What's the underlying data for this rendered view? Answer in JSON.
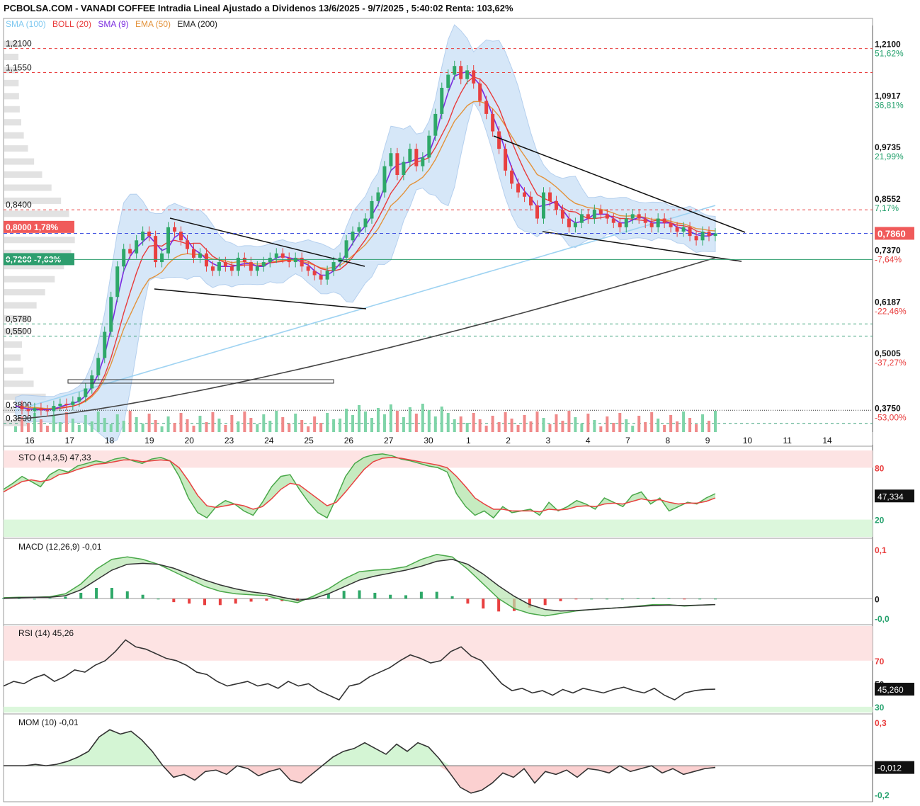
{
  "header": {
    "title": "PCBOLSA.COM - VANADI COFFEE Intradia Lineal Ajustado a Dividenos 13/6/2025 - 9/7/2025 , 5:40:02 Renta: 103,62%"
  },
  "legend": [
    {
      "label": "SMA (100)",
      "color": "#7ec8f0"
    },
    {
      "label": "BOLL (20)",
      "color": "#e83a3a"
    },
    {
      "label": "SMA (9)",
      "color": "#7a2be0"
    },
    {
      "label": "EMA (50)",
      "color": "#e3923a"
    },
    {
      "label": "EMA (200)",
      "color": "#222222"
    }
  ],
  "chart_data": [
    {
      "type": "candlestick",
      "name": "price",
      "x_ticks": [
        "16",
        "17",
        "18",
        "19",
        "20",
        "23",
        "24",
        "25",
        "26",
        "27",
        "30",
        "1",
        "2",
        "3",
        "4",
        "7",
        "8",
        "9",
        "10",
        "11",
        "14"
      ],
      "y_axis": {
        "levels": [
          {
            "value": 1.21,
            "label": "1,2100",
            "pct": "51,62%",
            "pct_color": "#22a06b"
          },
          {
            "value": 1.0917,
            "label": "1,0917",
            "pct": "36,81%",
            "pct_color": "#22a06b"
          },
          {
            "value": 0.9735,
            "label": "0,9735",
            "pct": "21,99%",
            "pct_color": "#22a06b"
          },
          {
            "value": 0.8552,
            "label": "0,8552",
            "pct": "7,17%",
            "pct_color": "#22a06b"
          },
          {
            "value": 0.737,
            "label": "0,7370",
            "pct": "-7,64%",
            "pct_color": "#e83a3a"
          },
          {
            "value": 0.6187,
            "label": "0,6187",
            "pct": "-22,46%",
            "pct_color": "#e83a3a"
          },
          {
            "value": 0.5005,
            "label": "0,5005",
            "pct": "-37,27%",
            "pct_color": "#e83a3a"
          },
          {
            "value": 0.375,
            "label": "0,3750",
            "pct": "-53,00%",
            "pct_color": "#e83a3a"
          }
        ],
        "ylim": [
          0.33,
          1.25
        ]
      },
      "left_levels": [
        {
          "value": 1.21,
          "label": "1,2100",
          "line": "red-dash"
        },
        {
          "value": 1.155,
          "label": "1,1550",
          "line": "red-dash"
        },
        {
          "value": 0.84,
          "label": "0,8400",
          "line": "red-dash"
        },
        {
          "value": 0.578,
          "label": "0,5780",
          "line": "green-dash"
        },
        {
          "value": 0.55,
          "label": "0,5500",
          "line": "green-dash"
        },
        {
          "value": 0.38,
          "label": "0,3800",
          "line": "black-dot"
        },
        {
          "value": 0.35,
          "label": "0,3500",
          "line": "green-dash"
        }
      ],
      "badges": [
        {
          "value": 0.8,
          "text": "0,8000  1,78%",
          "color": "#f05a5a"
        },
        {
          "value": 0.726,
          "text": "0,7260  -7,63%",
          "color": "#2e9e6e"
        }
      ],
      "last_price": {
        "value": 0.786,
        "label": "0,7860",
        "color": "#f05a5a"
      },
      "close_series": [
        0.39,
        0.382,
        0.378,
        0.385,
        0.38,
        0.378,
        0.39,
        0.395,
        0.392,
        0.4,
        0.41,
        0.43,
        0.46,
        0.5,
        0.56,
        0.64,
        0.71,
        0.75,
        0.74,
        0.77,
        0.79,
        0.78,
        0.72,
        0.74,
        0.8,
        0.79,
        0.77,
        0.75,
        0.73,
        0.74,
        0.71,
        0.7,
        0.72,
        0.71,
        0.7,
        0.73,
        0.72,
        0.7,
        0.71,
        0.72,
        0.73,
        0.74,
        0.73,
        0.72,
        0.73,
        0.71,
        0.7,
        0.69,
        0.68,
        0.7,
        0.72,
        0.73,
        0.77,
        0.79,
        0.8,
        0.82,
        0.86,
        0.88,
        0.94,
        0.97,
        0.92,
        0.95,
        0.98,
        0.94,
        0.96,
        1.01,
        1.06,
        1.12,
        1.15,
        1.17,
        1.14,
        1.16,
        1.13,
        1.09,
        1.06,
        1.02,
        0.98,
        0.93,
        0.9,
        0.88,
        0.87,
        0.85,
        0.82,
        0.88,
        0.86,
        0.84,
        0.82,
        0.8,
        0.81,
        0.83,
        0.82,
        0.84,
        0.83,
        0.82,
        0.81,
        0.8,
        0.82,
        0.83,
        0.82,
        0.81,
        0.8,
        0.82,
        0.81,
        0.8,
        0.79,
        0.8,
        0.78,
        0.77,
        0.79,
        0.78,
        0.786
      ]
    },
    {
      "type": "line",
      "name": "STO (14,3,5)",
      "label": "STO (14,3,5)",
      "value_text": "47,33",
      "last_label": "47,334",
      "ticks": [
        {
          "value": 80,
          "label": "80"
        },
        {
          "value": 20,
          "label": "20"
        }
      ],
      "ylim": [
        0,
        100
      ],
      "k": [
        55,
        62,
        70,
        64,
        58,
        72,
        78,
        75,
        82,
        85,
        88,
        86,
        90,
        92,
        88,
        85,
        90,
        92,
        88,
        70,
        45,
        28,
        22,
        35,
        42,
        38,
        30,
        25,
        40,
        58,
        70,
        72,
        55,
        40,
        28,
        22,
        45,
        70,
        85,
        92,
        95,
        96,
        94,
        90,
        88,
        85,
        82,
        80,
        75,
        50,
        35,
        25,
        30,
        22,
        35,
        28,
        30,
        32,
        25,
        40,
        30,
        35,
        42,
        38,
        32,
        45,
        40,
        35,
        48,
        52,
        38,
        45,
        30,
        35,
        40,
        38,
        45,
        50
      ],
      "d": [
        52,
        58,
        64,
        66,
        64,
        66,
        72,
        74,
        78,
        81,
        84,
        85,
        87,
        89,
        89,
        87,
        88,
        89,
        88,
        80,
        65,
        48,
        36,
        34,
        36,
        38,
        36,
        32,
        35,
        44,
        55,
        62,
        60,
        52,
        44,
        36,
        40,
        52,
        65,
        78,
        87,
        91,
        92,
        91,
        89,
        87,
        85,
        83,
        80,
        70,
        58,
        45,
        38,
        32,
        32,
        30,
        30,
        30,
        29,
        32,
        31,
        32,
        35,
        36,
        35,
        38,
        39,
        38,
        41,
        44,
        42,
        43,
        40,
        38,
        39,
        39,
        41,
        45
      ]
    },
    {
      "type": "bar+line",
      "name": "MACD (12,26,9)",
      "label": "MACD (12,26,9)",
      "value_text": "-0,01",
      "ticks": [
        {
          "value": 0.1,
          "label": "0,1"
        },
        {
          "value": 0,
          "label": "0"
        },
        {
          "value": -0.04,
          "label": "-0,0"
        }
      ],
      "ylim": [
        -0.05,
        0.12
      ],
      "macd": [
        0.002,
        0.003,
        0.003,
        0.004,
        0.01,
        0.03,
        0.06,
        0.08,
        0.085,
        0.08,
        0.07,
        0.055,
        0.04,
        0.025,
        0.015,
        0.01,
        0.008,
        0.006,
        -0.002,
        -0.008,
        0.005,
        0.02,
        0.04,
        0.055,
        0.058,
        0.06,
        0.065,
        0.08,
        0.09,
        0.085,
        0.06,
        0.03,
        0.0,
        -0.02,
        -0.03,
        -0.035,
        -0.03,
        -0.025,
        -0.022,
        -0.02,
        -0.018,
        -0.015,
        -0.012,
        -0.012,
        -0.015,
        -0.013,
        -0.012
      ],
      "signal": [
        0.001,
        0.002,
        0.003,
        0.003,
        0.006,
        0.018,
        0.038,
        0.058,
        0.07,
        0.072,
        0.07,
        0.062,
        0.05,
        0.038,
        0.028,
        0.02,
        0.014,
        0.01,
        0.003,
        -0.003,
        0.0,
        0.01,
        0.024,
        0.038,
        0.046,
        0.052,
        0.058,
        0.066,
        0.076,
        0.08,
        0.07,
        0.05,
        0.026,
        0.005,
        -0.012,
        -0.022,
        -0.025,
        -0.024,
        -0.022,
        -0.02,
        -0.018,
        -0.016,
        -0.014,
        -0.013,
        -0.014,
        -0.013,
        -0.012
      ],
      "hist": [
        0.001,
        0.001,
        0.0,
        0.001,
        0.004,
        0.012,
        0.022,
        0.022,
        0.015,
        0.008,
        0.0,
        -0.007,
        -0.01,
        -0.013,
        -0.013,
        -0.01,
        -0.006,
        -0.004,
        -0.005,
        -0.005,
        0.005,
        0.01,
        0.016,
        0.017,
        0.012,
        0.008,
        0.007,
        0.014,
        0.014,
        0.005,
        -0.01,
        -0.02,
        -0.026,
        -0.025,
        -0.018,
        -0.013,
        -0.005,
        -0.001,
        0.0,
        0.0,
        0.0,
        0.001,
        0.002,
        0.001,
        -0.001,
        0.0,
        0.0
      ]
    },
    {
      "type": "line",
      "name": "RSI (14)",
      "label": "RSI (14)",
      "value_text": "45,26",
      "last_label": "45,260",
      "ticks": [
        {
          "value": 70,
          "label": "70"
        },
        {
          "value": 50,
          "label": "50"
        },
        {
          "value": 30,
          "label": "30"
        }
      ],
      "ylim": [
        25,
        100
      ],
      "values": [
        48,
        52,
        50,
        55,
        58,
        52,
        56,
        62,
        60,
        66,
        70,
        78,
        88,
        82,
        80,
        76,
        72,
        70,
        66,
        60,
        58,
        52,
        48,
        50,
        52,
        48,
        50,
        46,
        52,
        48,
        50,
        44,
        40,
        36,
        48,
        50,
        56,
        60,
        64,
        70,
        75,
        72,
        68,
        70,
        78,
        82,
        74,
        70,
        60,
        50,
        44,
        46,
        42,
        44,
        40,
        45,
        42,
        46,
        44,
        42,
        45,
        47,
        44,
        42,
        46,
        40,
        36,
        42,
        44,
        45,
        45.26
      ]
    },
    {
      "type": "area",
      "name": "MOM (10)",
      "label": "MOM (10)",
      "value_text": "-0,01",
      "last_label": "-0,012",
      "ticks": [
        {
          "value": 0.3,
          "label": "0,3"
        },
        {
          "value": -0.2,
          "label": "-0,2"
        }
      ],
      "ylim": [
        -0.25,
        0.35
      ],
      "values": [
        0.0,
        0.0,
        0.0,
        0.01,
        0.0,
        0.01,
        0.03,
        0.06,
        0.1,
        0.2,
        0.25,
        0.22,
        0.24,
        0.18,
        0.1,
        0.0,
        -0.08,
        -0.06,
        -0.1,
        -0.04,
        -0.03,
        -0.06,
        0.0,
        -0.02,
        -0.07,
        -0.04,
        -0.02,
        -0.1,
        -0.12,
        -0.06,
        0.0,
        0.06,
        0.1,
        0.12,
        0.16,
        0.12,
        0.08,
        0.15,
        0.1,
        0.16,
        0.13,
        0.05,
        -0.05,
        -0.15,
        -0.19,
        -0.17,
        -0.12,
        -0.05,
        -0.08,
        -0.02,
        -0.12,
        -0.04,
        -0.06,
        -0.03,
        -0.08,
        -0.02,
        -0.03,
        -0.05,
        0.0,
        -0.04,
        -0.02,
        0.0,
        -0.05,
        -0.02,
        -0.06,
        -0.04,
        -0.02,
        -0.012
      ]
    }
  ]
}
